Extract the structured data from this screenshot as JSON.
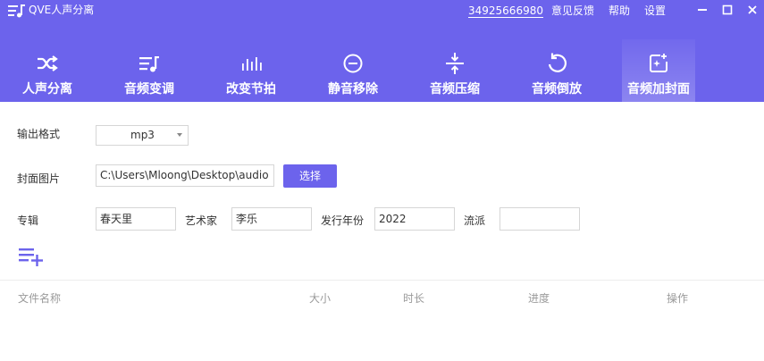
{
  "app": {
    "title": "QVE人声分离",
    "phone": "34925666980",
    "menu": {
      "feedback": "意见反馈",
      "help": "帮助",
      "settings": "设置"
    }
  },
  "toolbar": {
    "items": [
      {
        "label": "人声分离",
        "icon": "shuffle-icon"
      },
      {
        "label": "音频变调",
        "icon": "music-list-icon"
      },
      {
        "label": "改变节拍",
        "icon": "equalizer-bars-icon"
      },
      {
        "label": "静音移除",
        "icon": "minus-circle-icon"
      },
      {
        "label": "音频压缩",
        "icon": "compress-arrows-icon"
      },
      {
        "label": "音频倒放",
        "icon": "undo-circle-icon"
      },
      {
        "label": "音频加封面",
        "icon": "image-add-icon"
      }
    ],
    "active": "音频加封面"
  },
  "form": {
    "output_format_label": "输出格式",
    "output_format_value": "mp3",
    "cover_label": "封面图片",
    "cover_path": "C:\\Users\\Mloong\\Desktop\\audio",
    "choose_button": "选择",
    "album_label": "专辑",
    "album_value": "春天里",
    "artist_label": "艺术家",
    "artist_value": "李乐",
    "year_label": "发行年份",
    "year_value": "2022",
    "genre_label": "流派",
    "genre_value": ""
  },
  "table": {
    "columns": [
      "文件名称",
      "大小",
      "时长",
      "进度",
      "操作"
    ]
  },
  "colors": {
    "header_bg": "#6c63ec",
    "accent": "#6c63ec",
    "text": "#333333",
    "muted": "#9a9a9a"
  }
}
